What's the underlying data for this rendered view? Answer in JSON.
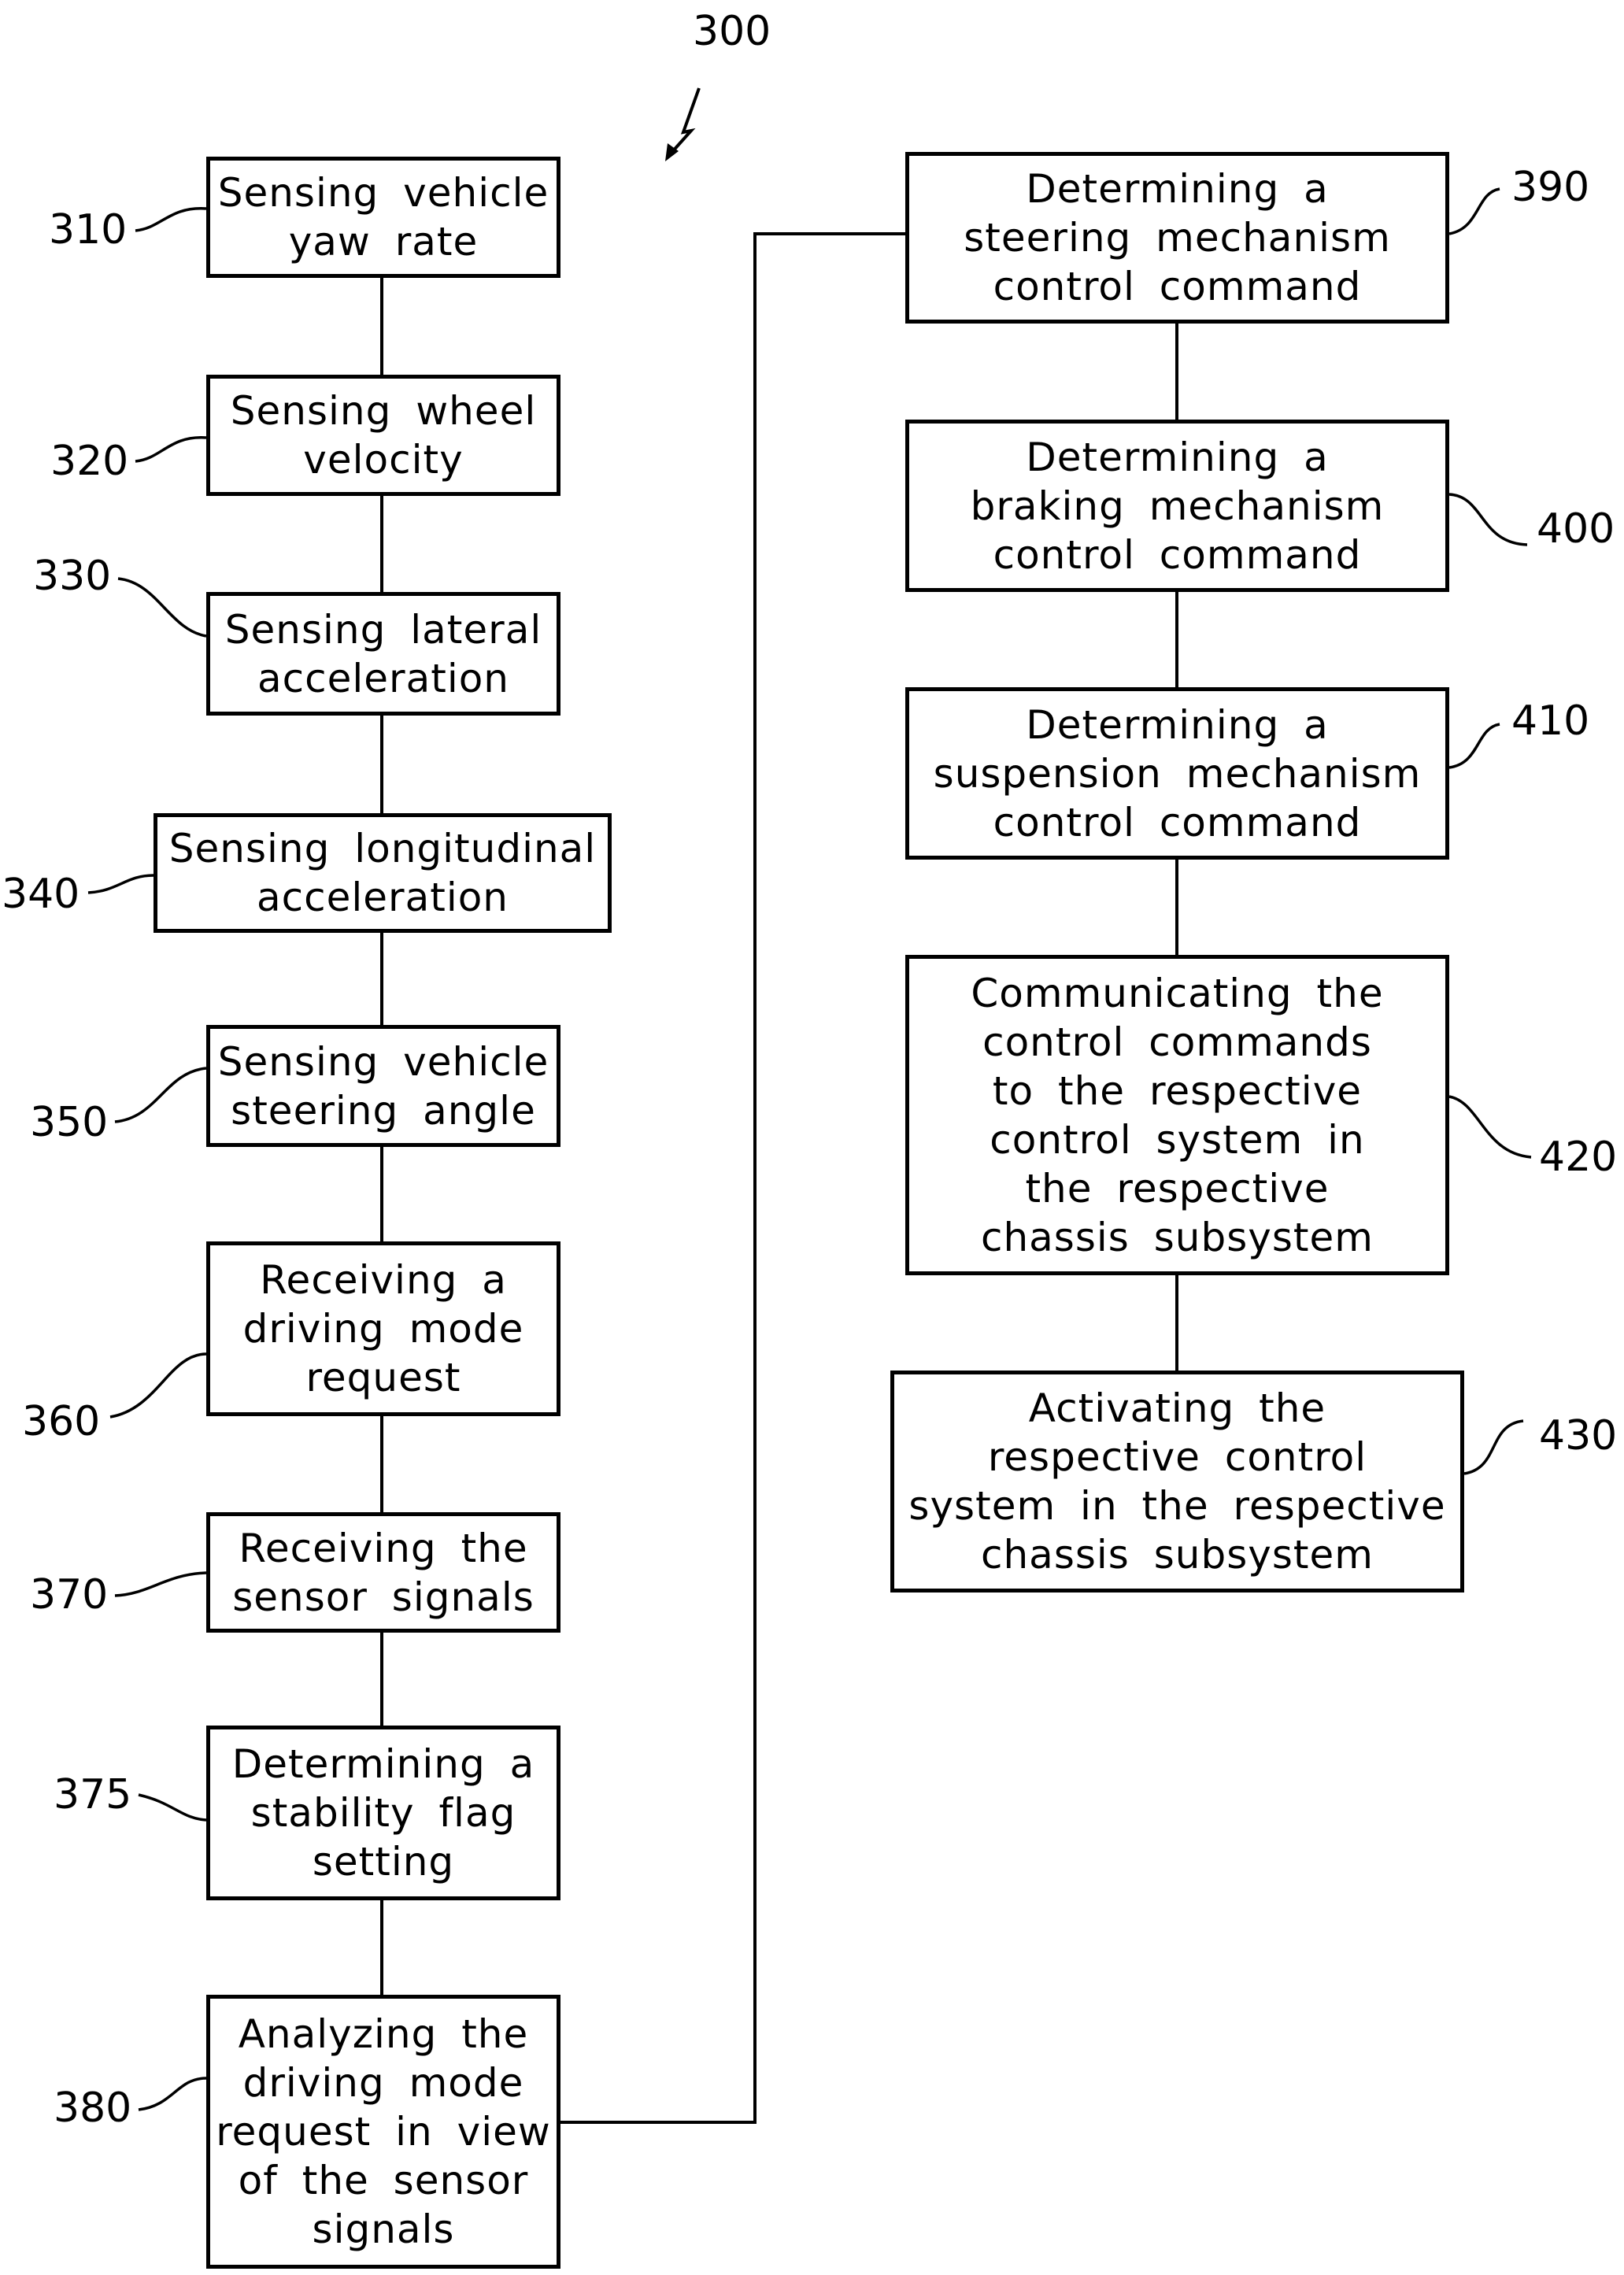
{
  "figure": {
    "reference": "300",
    "steps": [
      {
        "ref": "310",
        "text": "Sensing vehicle\nyaw rate"
      },
      {
        "ref": "320",
        "text": "Sensing wheel\nvelocity"
      },
      {
        "ref": "330",
        "text": "Sensing lateral\nacceleration"
      },
      {
        "ref": "340",
        "text": "Sensing longitudinal\nacceleration"
      },
      {
        "ref": "350",
        "text": "Sensing vehicle\nsteering angle"
      },
      {
        "ref": "360",
        "text": "Receiving a\ndriving mode\nrequest"
      },
      {
        "ref": "370",
        "text": "Receiving the\nsensor signals"
      },
      {
        "ref": "375",
        "text": "Determining a\nstability flag\nsetting"
      },
      {
        "ref": "380",
        "text": "Analyzing the\ndriving mode\nrequest in view\nof the sensor\nsignals"
      },
      {
        "ref": "390",
        "text": "Determining a\nsteering mechanism\ncontrol command"
      },
      {
        "ref": "400",
        "text": "Determining a\nbraking mechanism\ncontrol command"
      },
      {
        "ref": "410",
        "text": "Determining a\nsuspension mechanism\ncontrol command"
      },
      {
        "ref": "420",
        "text": "Communicating the\ncontrol commands\nto the respective\ncontrol system in\nthe respective\nchassis subsystem"
      },
      {
        "ref": "430",
        "text": "Activating the\nrespective control\nsystem in the respective\nchassis subsystem"
      }
    ]
  }
}
